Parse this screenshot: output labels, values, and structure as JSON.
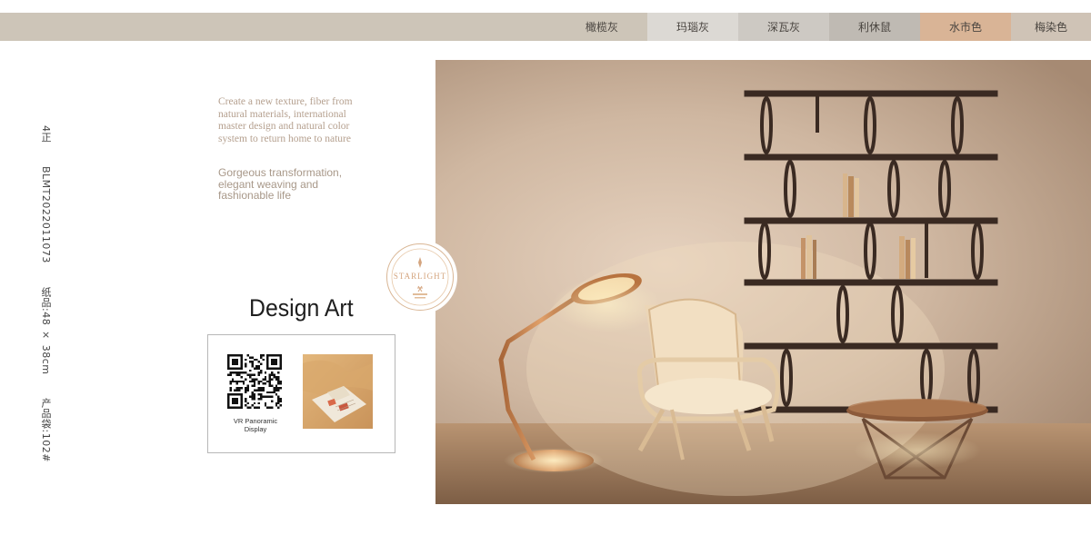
{
  "color_swatches": [
    {
      "name": "橄榄灰",
      "color": "#cdc5b8"
    },
    {
      "name": "玛瑙灰",
      "color": "#dcd9d4"
    },
    {
      "name": "深瓦灰",
      "color": "#cdc9c3"
    },
    {
      "name": "利休鼠",
      "color": "#bfbab3"
    },
    {
      "name": "水市色",
      "color": "#d9b496"
    },
    {
      "name": "梅染色",
      "color": "#cfc3b6"
    }
  ],
  "product_info": {
    "page": "4正",
    "code": "BLMT2022011073",
    "spec": "纸品:48 × 38cm",
    "bag": "产品袋:102#"
  },
  "intro": {
    "serif_text": "Create a new texture, fiber from natural materials, international master design and natural color system to return home to nature",
    "sans_text": "Gorgeous transformation, elegant weaving and fashionable life"
  },
  "stamp": {
    "brand": "STARLIGHT"
  },
  "design_title": "Design Art",
  "qr_section": {
    "label": "VR Panoramic Display",
    "qr_icon": "qr-code-icon"
  },
  "photo": {
    "description_icon": "interior-photo",
    "accent": "#c98a55"
  }
}
